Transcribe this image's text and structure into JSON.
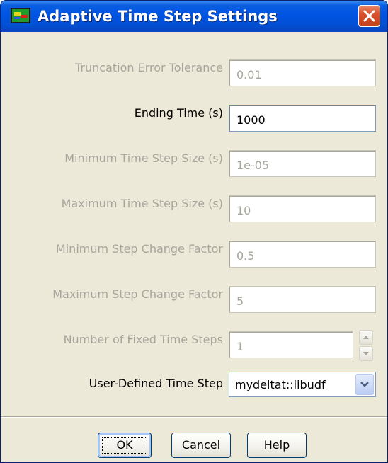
{
  "window": {
    "title": "Adaptive Time Step Settings"
  },
  "fields": [
    {
      "label": "Truncation Error Tolerance",
      "value": "0.01",
      "enabled": false
    },
    {
      "label": "Ending Time (s)",
      "value": "1000",
      "enabled": true
    },
    {
      "label": "Minimum Time Step Size (s)",
      "value": "1e-05",
      "enabled": false
    },
    {
      "label": "Maximum Time Step Size (s)",
      "value": "10",
      "enabled": false
    },
    {
      "label": "Minimum Step Change Factor",
      "value": "0.5",
      "enabled": false
    },
    {
      "label": "Maximum Step Change Factor",
      "value": "5",
      "enabled": false
    },
    {
      "label": "Number of Fixed Time Steps",
      "value": "1",
      "enabled": false
    }
  ],
  "udf": {
    "label": "User-Defined Time Step",
    "selected": "mydeltat::libudf"
  },
  "buttons": {
    "ok": "OK",
    "cancel": "Cancel",
    "help": "Help"
  },
  "icons": {
    "app": "fluent-app-icon",
    "close": "close-icon",
    "spin_up": "spin-up-icon",
    "spin_down": "spin-down-icon",
    "combo_arrow": "chevron-down-icon"
  },
  "colors": {
    "titlebar": "#0054e3",
    "dialog_bg": "#ece9d8",
    "disabled_text": "#a7a69c",
    "close_button": "#d9512c"
  }
}
